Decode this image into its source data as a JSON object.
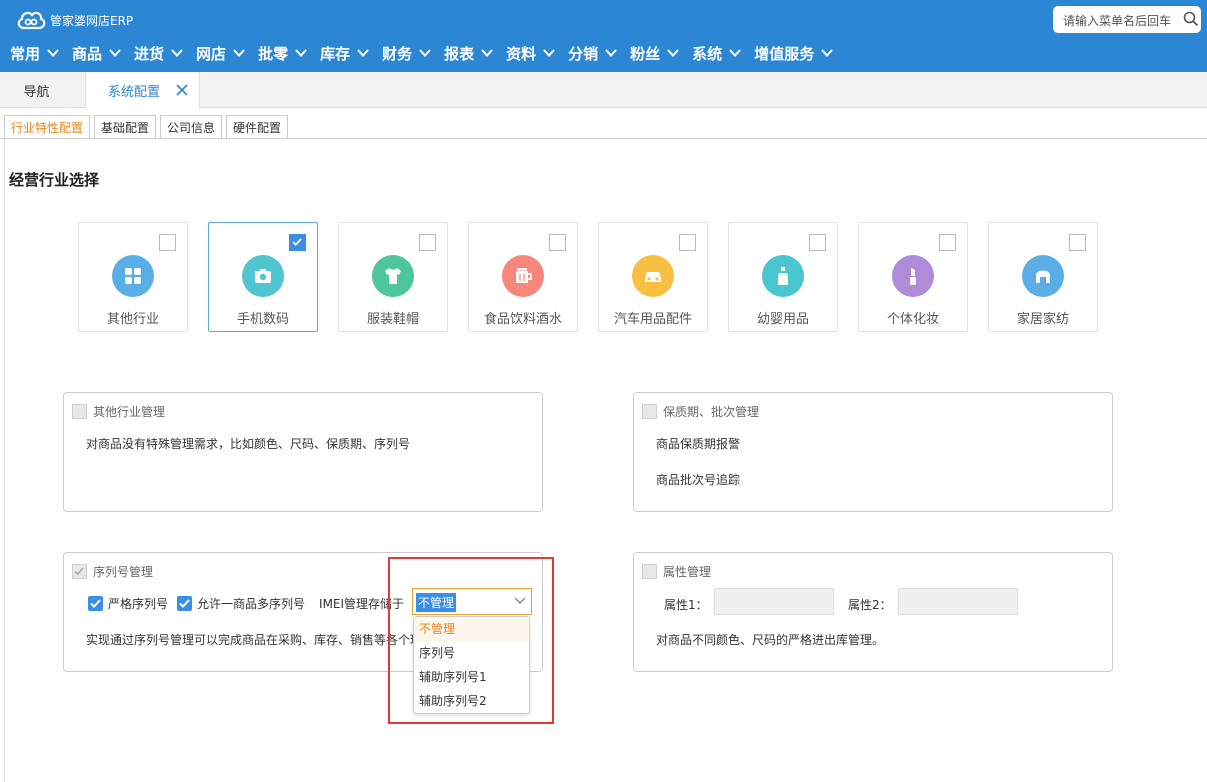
{
  "app": {
    "logo_text": "管家婆网店ERP",
    "search_placeholder": "请输入菜单名后回车"
  },
  "menu": [
    "常用",
    "商品",
    "进货",
    "网店",
    "批零",
    "库存",
    "财务",
    "报表",
    "资料",
    "分销",
    "粉丝",
    "系统",
    "增值服务"
  ],
  "tabs": {
    "nav": "导航",
    "active": "系统配置"
  },
  "subtabs": [
    "行业特性配置",
    "基础配置",
    "公司信息",
    "硬件配置"
  ],
  "section_title": "经营行业选择",
  "industries": [
    {
      "label": "其他行业",
      "checked": false,
      "color": "#58aee5",
      "icon": "grid-icon"
    },
    {
      "label": "手机数码",
      "checked": true,
      "color": "#4fc6d0",
      "icon": "camera-icon"
    },
    {
      "label": "服装鞋帽",
      "checked": false,
      "color": "#4cc69a",
      "icon": "shirt-icon"
    },
    {
      "label": "食品饮料酒水",
      "checked": false,
      "color": "#f6857a",
      "icon": "cup-icon"
    },
    {
      "label": "汽车用品配件",
      "checked": false,
      "color": "#f7c042",
      "icon": "car-icon"
    },
    {
      "label": "幼婴用品",
      "checked": false,
      "color": "#49c6cf",
      "icon": "bottle-icon"
    },
    {
      "label": "个体化妆",
      "checked": false,
      "color": "#b08bd8",
      "icon": "lipstick-icon"
    },
    {
      "label": "家居家纺",
      "checked": false,
      "color": "#5aaee6",
      "icon": "home-icon"
    }
  ],
  "panels": {
    "other": {
      "title": "其他行业管理",
      "desc": "对商品没有特殊管理需求，比如颜色、尺码、保质期、序列号"
    },
    "shelf": {
      "title": "保质期、批次管理",
      "line1": "商品保质期报警",
      "line2": "商品批次号追踪"
    },
    "serial": {
      "title": "序列号管理",
      "strict_label": "严格序列号",
      "multi_label": "允许一商品多序列号",
      "imei_label": "IMEI管理存储于",
      "selected": "不管理",
      "desc": "实现通过序列号管理可以完成商品在采购、库存、销售等各个环",
      "options": [
        "不管理",
        "序列号",
        "辅助序列号1",
        "辅助序列号2"
      ]
    },
    "attr": {
      "title": "属性管理",
      "attr1_label": "属性1：",
      "attr2_label": "属性2：",
      "desc": "对商品不同颜色、尺码的严格进出库管理。"
    }
  },
  "colors": {
    "brand": "#2b87d3",
    "accent": "#e8861a",
    "checkbox": "#3a8ee6",
    "highlight": "#e53935"
  }
}
